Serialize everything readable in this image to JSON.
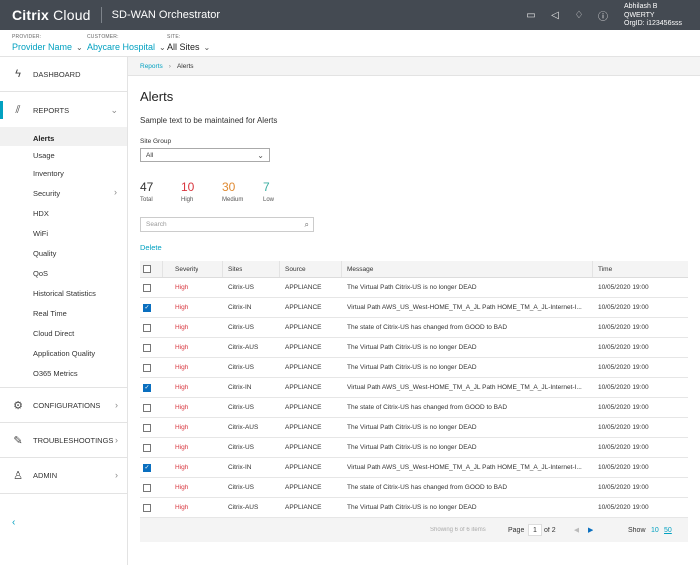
{
  "header": {
    "brand_strong": "Citrix",
    "brand_light": " Cloud",
    "app_title": "SD-WAN Orchestrator",
    "icons": [
      "chat-icon",
      "megaphone-icon",
      "bell-icon",
      "help-icon"
    ],
    "user": {
      "name": "Abhilash B",
      "org": "QWERTY",
      "org_id": "OrgID: i123456sss"
    }
  },
  "context": {
    "provider_label": "PROVIDER:",
    "provider_value": "Provider Name",
    "customer_label": "CUSTOMER:",
    "customer_value": "Abycare Hospital",
    "site_label": "SITE:",
    "site_value": "All Sites"
  },
  "sidebar": {
    "dashboard": "DASHBOARD",
    "reports": "REPORTS",
    "report_items": [
      "Alerts",
      "Usage",
      "Inventory",
      "Security",
      "HDX",
      "WiFi",
      "Quality",
      "QoS",
      "Historical Statistics",
      "Real Time",
      "Cloud Direct",
      "Application Quality",
      "O365 Metrics"
    ],
    "configurations": "CONFIGURATIONS",
    "troubleshootings": "TROUBLESHOOTINGS",
    "admin": "ADMIN"
  },
  "breadcrumb": {
    "parent": "Reports",
    "current": "Alerts"
  },
  "page": {
    "title": "Alerts",
    "subtext": "Sample text to be maintained for Alerts",
    "site_group_label": "Site Group",
    "site_group_value": "All",
    "search_placeholder": "Search",
    "delete_label": "Delete"
  },
  "counts": {
    "total": {
      "value": "47",
      "label": "Total"
    },
    "high": {
      "value": "10",
      "label": "High"
    },
    "medium": {
      "value": "30",
      "label": "Medium"
    },
    "low": {
      "value": "7",
      "label": "Low"
    }
  },
  "table": {
    "columns": {
      "severity": "Severity",
      "sites": "Sites",
      "source": "Source",
      "message": "Message",
      "time": "Time"
    },
    "rows": [
      {
        "checked": false,
        "severity": "High",
        "site": "Citrix-US",
        "source": "APPLIANCE",
        "message": "The Virtual Path Citrix-US is no longer DEAD",
        "time": "10/05/2020 19:00"
      },
      {
        "checked": true,
        "severity": "High",
        "site": "Citrix-IN",
        "source": "APPLIANCE",
        "message": "Virtual Path AWS_US_West-HOME_TM_A_JL Path HOME_TM_A_JL-Internet-I...",
        "time": "10/05/2020 19:00"
      },
      {
        "checked": false,
        "severity": "High",
        "site": "Citrix-US",
        "source": "APPLIANCE",
        "message": "The state of Citrix-US has changed from GOOD to BAD",
        "time": "10/05/2020 19:00"
      },
      {
        "checked": false,
        "severity": "High",
        "site": "Citrix-AUS",
        "source": "APPLIANCE",
        "message": "The Virtual Path Citrix-US is no longer DEAD",
        "time": "10/05/2020 19:00"
      },
      {
        "checked": false,
        "severity": "High",
        "site": "Citrix-US",
        "source": "APPLIANCE",
        "message": "The Virtual Path Citrix-US is no longer DEAD",
        "time": "10/05/2020 19:00"
      },
      {
        "checked": true,
        "severity": "High",
        "site": "Citrix-IN",
        "source": "APPLIANCE",
        "message": "Virtual Path AWS_US_West-HOME_TM_A_JL Path HOME_TM_A_JL-Internet-I...",
        "time": "10/05/2020 19:00"
      },
      {
        "checked": false,
        "severity": "High",
        "site": "Citrix-US",
        "source": "APPLIANCE",
        "message": "The state of Citrix-US has changed from GOOD to BAD",
        "time": "10/05/2020 19:00"
      },
      {
        "checked": false,
        "severity": "High",
        "site": "Citrix-AUS",
        "source": "APPLIANCE",
        "message": "The Virtual Path Citrix-US is no longer DEAD",
        "time": "10/05/2020 19:00"
      },
      {
        "checked": false,
        "severity": "High",
        "site": "Citrix-US",
        "source": "APPLIANCE",
        "message": "The Virtual Path Citrix-US is no longer DEAD",
        "time": "10/05/2020 19:00"
      },
      {
        "checked": true,
        "severity": "High",
        "site": "Citrix-IN",
        "source": "APPLIANCE",
        "message": "Virtual Path AWS_US_West-HOME_TM_A_JL Path HOME_TM_A_JL-Internet-I...",
        "time": "10/05/2020 19:00"
      },
      {
        "checked": false,
        "severity": "High",
        "site": "Citrix-US",
        "source": "APPLIANCE",
        "message": "The state of Citrix-US has changed from GOOD to BAD",
        "time": "10/05/2020 19:00"
      },
      {
        "checked": false,
        "severity": "High",
        "site": "Citrix-AUS",
        "source": "APPLIANCE",
        "message": "The Virtual Path Citrix-US is no longer DEAD",
        "time": "10/05/2020 19:00"
      }
    ],
    "footer": {
      "info": "Showing 6 of 6 items",
      "page_label": "Page",
      "page_value": "1",
      "of_label": "of 2",
      "show_label": "Show",
      "option_10": "10",
      "option_50": "50"
    }
  },
  "colors": {
    "accent": "#02a1c1",
    "header": "#444a52",
    "high": "#d9363e",
    "medium": "#e08a32",
    "low": "#3aaea0"
  }
}
